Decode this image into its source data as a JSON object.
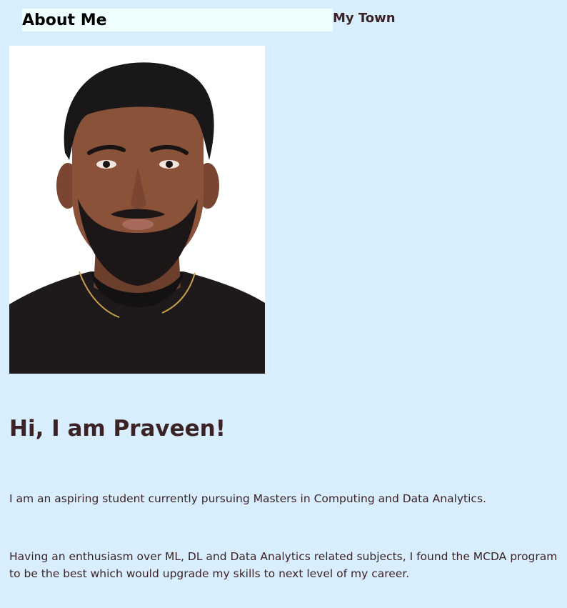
{
  "nav": {
    "items": [
      {
        "label": "About Me",
        "active": true
      },
      {
        "label": "My Town",
        "active": false
      }
    ]
  },
  "main": {
    "photo_alt": "Portrait photo of Praveen",
    "heading": "Hi, I am Praveen!",
    "paragraphs": [
      "I am an aspiring student currently pursuing Masters in Computing and Data Analytics.",
      "Having an enthusiasm over ML, DL and Data Analytics related subjects, I found the MCDA program to be the best which would upgrade my skills to next level of my career."
    ]
  },
  "colors": {
    "page_background": "#d9eefc",
    "active_nav_background": "#eefffd",
    "text": "#3b2226"
  }
}
